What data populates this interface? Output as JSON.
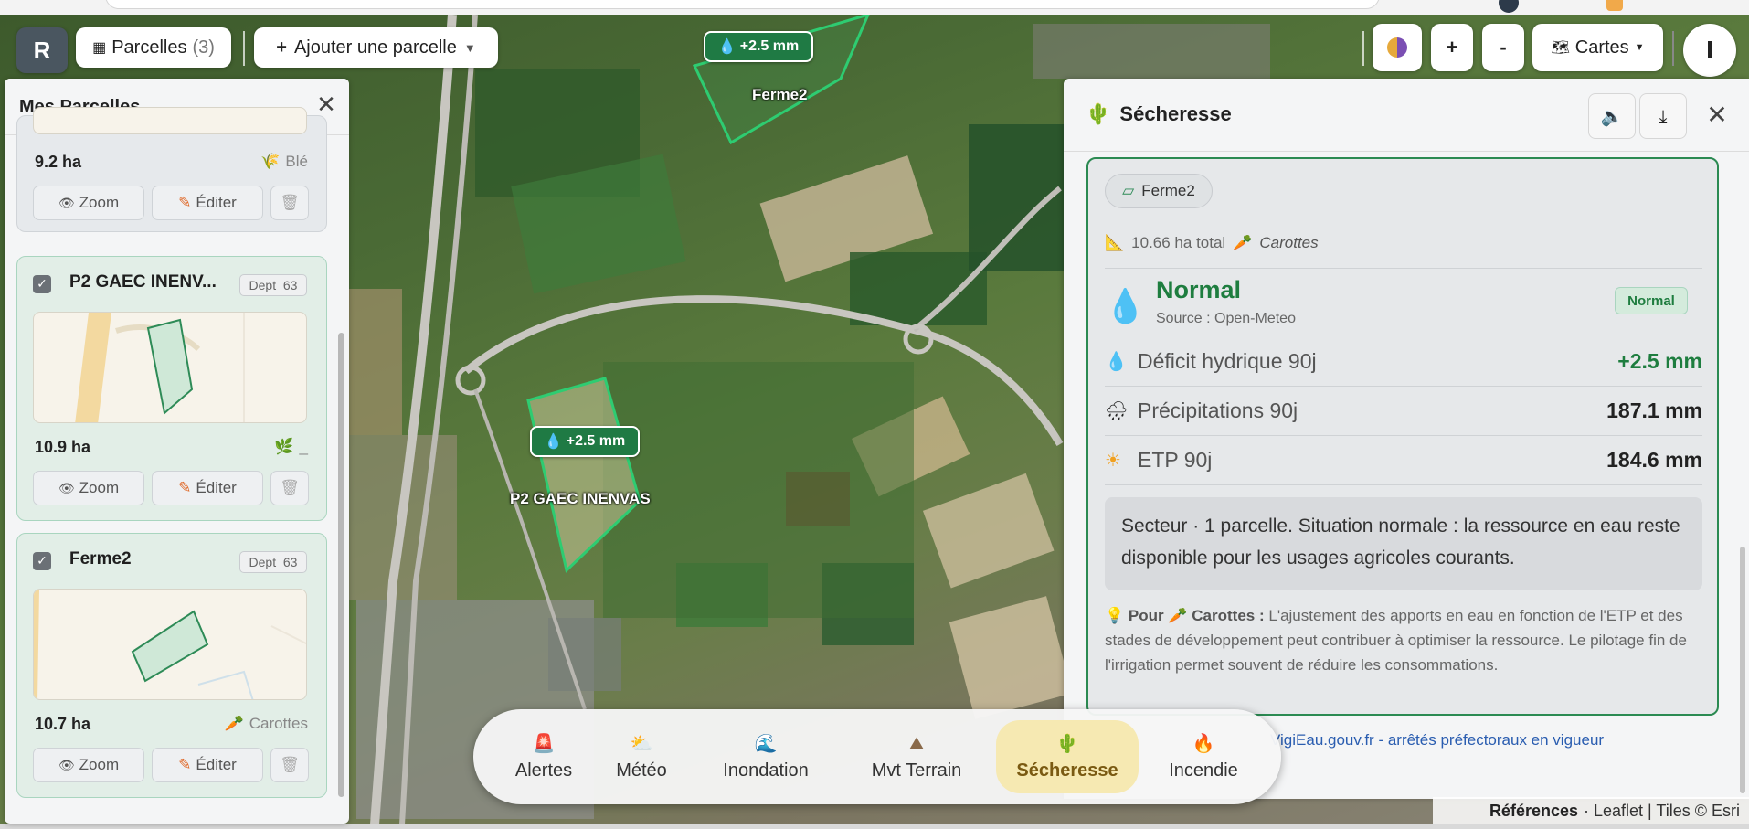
{
  "topbar": {
    "logo": "R",
    "parcelles_label": "Parcelles",
    "parcelles_count": "(3)",
    "add_label": "Ajouter une parcelle",
    "zoom_in": "+",
    "zoom_out": "-",
    "layers_label": "Cartes",
    "user_initial": "I"
  },
  "sidebar": {
    "title": "Mes Parcelles",
    "zoom_label": "Zoom",
    "edit_label": "Éditer",
    "cards": [
      {
        "area": "9.2 ha",
        "crop": "Blé"
      },
      {
        "name": "P2 GAEC INENV...",
        "dept": "Dept_63",
        "area": "10.9 ha",
        "crop": "_"
      },
      {
        "name": "Ferme2",
        "dept": "Dept_63",
        "area": "10.7 ha",
        "crop": "Carottes"
      }
    ]
  },
  "map": {
    "badge_top": "+2.5 mm",
    "badge_mid": "+2.5 mm",
    "label_ferme2": "Ferme2",
    "label_p2": "P2 GAEC INENVAS"
  },
  "panel": {
    "title": "Sécheresse",
    "chip": "Ferme2",
    "total_area": "10.66 ha total",
    "crop": "Carottes",
    "status": "Normal",
    "source": "Source : Open-Meteo",
    "status_badge": "Normal",
    "metrics": [
      {
        "label": "Déficit hydrique 90j",
        "value": "+2.5 mm"
      },
      {
        "label": "Précipitations 90j",
        "value": "187.1 mm"
      },
      {
        "label": "ETP 90j",
        "value": "184.6 mm"
      }
    ],
    "summary": "Secteur · 1 parcelle. Situation normale : la ressource en eau reste disponible pour les usages agricoles courants.",
    "advice_prefix": "Pour",
    "advice_crop": "Carottes :",
    "advice_text": "L'ajustement des apports en eau en fonction de l'ETP et des stades de développement peut contribuer à optimiser la ressource. Le pilotage fin de l'irrigation permet souvent de réduire les consommations.",
    "link": "VigiEau.gouv.fr - arrêtés préfectoraux en vigueur"
  },
  "attribution": {
    "references": "Références",
    "rest": "· Leaflet | Tiles © Esri"
  },
  "dock": {
    "items": [
      {
        "label": "Alertes",
        "icon": "siren-icon"
      },
      {
        "label": "Météo",
        "icon": "weather-icon"
      },
      {
        "label": "Inondation",
        "icon": "wave-icon"
      },
      {
        "label": "Mvt Terrain",
        "icon": "mountain-icon"
      },
      {
        "label": "Sécheresse",
        "icon": "cactus-icon"
      },
      {
        "label": "Incendie",
        "icon": "fire-icon"
      }
    ]
  },
  "colors": {
    "accent_green": "#1e7d3f",
    "parcel_outline": "#2ecc71",
    "active_tab": "#f6e9b2"
  }
}
